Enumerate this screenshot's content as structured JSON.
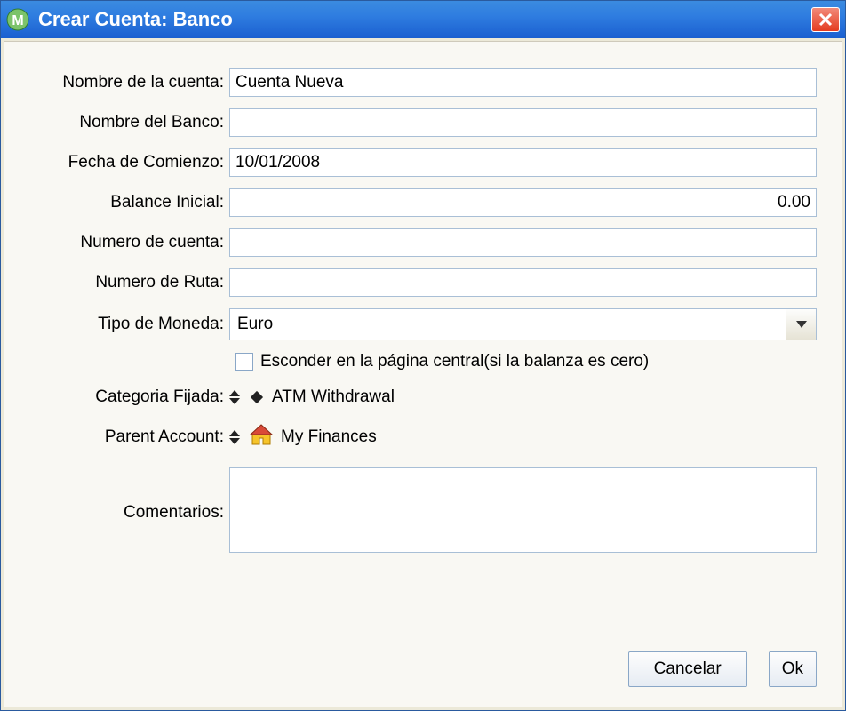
{
  "window": {
    "title": "Crear Cuenta: Banco"
  },
  "labels": {
    "account_name": "Nombre de la cuenta:",
    "bank_name": "Nombre del Banco:",
    "start_date": "Fecha de Comienzo:",
    "initial_balance": "Balance Inicial:",
    "account_number": "Numero de cuenta:",
    "routing_number": "Numero de Ruta:",
    "currency_type": "Tipo de Moneda:",
    "fixed_category": "Categoria Fijada:",
    "parent_account": "Parent Account:",
    "comments": "Comentarios:"
  },
  "fields": {
    "account_name": "Cuenta Nueva",
    "bank_name": "",
    "start_date": "10/01/2008",
    "initial_balance": "0.00",
    "account_number": "",
    "routing_number": "",
    "currency_type": "Euro",
    "hide_checkbox_label": "Esconder en la página central(si la balanza es cero)",
    "fixed_category": "ATM Withdrawal",
    "parent_account": "My Finances",
    "comments": ""
  },
  "buttons": {
    "cancel": "Cancelar",
    "ok": "Ok"
  }
}
